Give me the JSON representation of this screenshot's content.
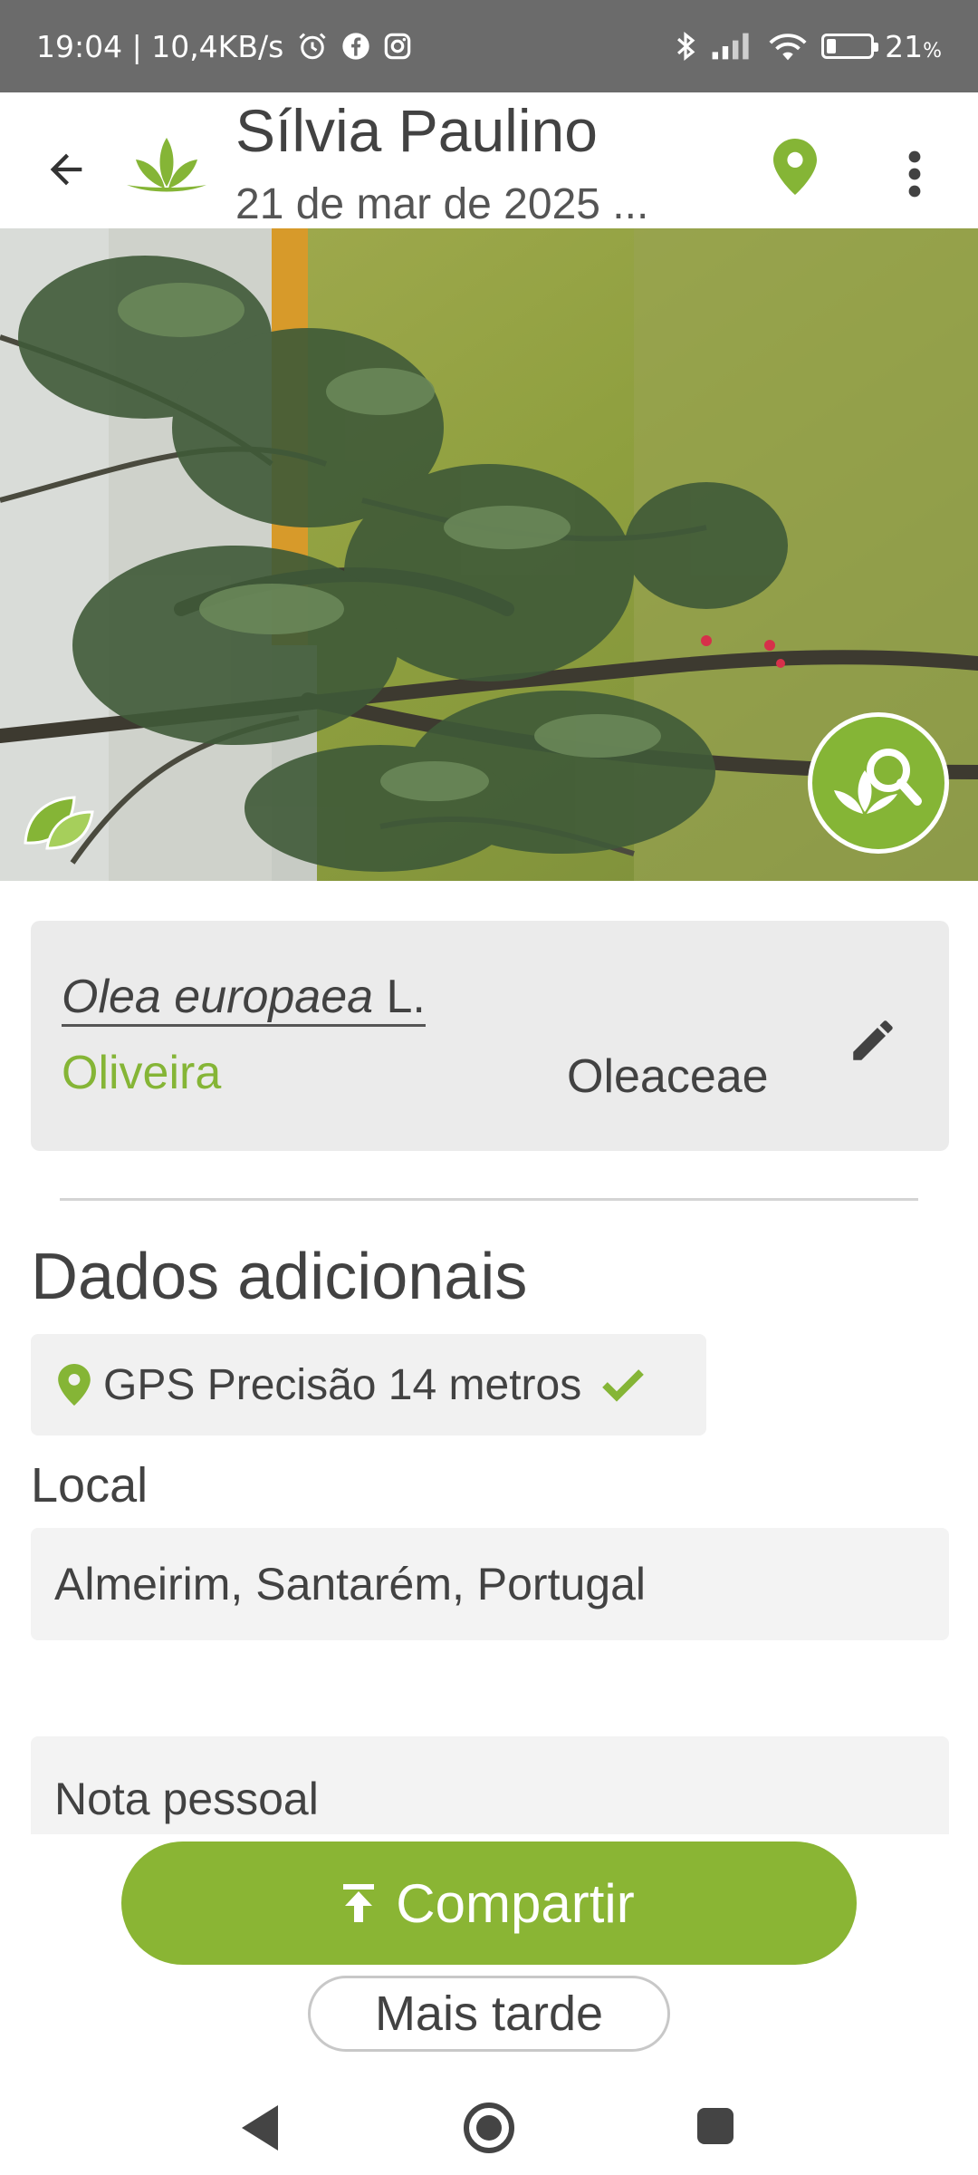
{
  "status_bar": {
    "time_speed": "19:04 | 10,4KB/s",
    "battery": "21",
    "battery_unit": "%",
    "battery_level": 0.21,
    "icons": [
      "alarm-icon",
      "facebook-icon",
      "instagram-icon",
      "bluetooth-icon",
      "signal-icon",
      "wifi-icon",
      "battery-icon"
    ]
  },
  "header": {
    "title": "Sílvia Paulino",
    "subtitle": "21 de mar de 2025 ..."
  },
  "species": {
    "scientific_name": "Olea europaea",
    "author": "L.",
    "common_name": "Oliveira",
    "family": "Oleaceae"
  },
  "additional": {
    "section_title": "Dados adicionais",
    "gps_text": "GPS Precisão 14 metros",
    "local_label": "Local",
    "local_value": "Almeirim, Santarém, Portugal",
    "note_placeholder": "Nota pessoal"
  },
  "actions": {
    "share_label": "Compartir",
    "later_label": "Mais tarde"
  },
  "colors": {
    "accent_green": "#85b536",
    "button_green": "#8ab534",
    "status_bar": "#6b6b6b",
    "text": "#424242"
  }
}
